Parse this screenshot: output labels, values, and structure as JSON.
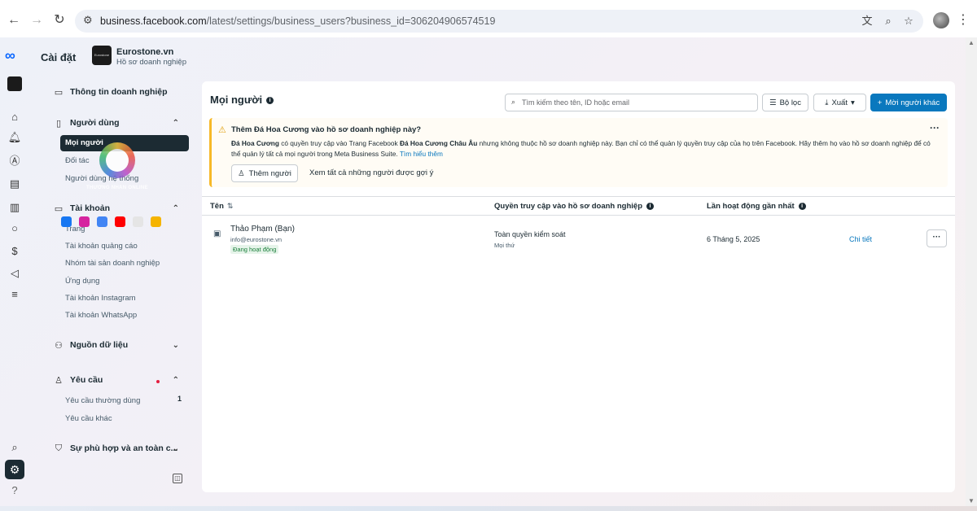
{
  "browser": {
    "url_domain": "business.facebook.com",
    "url_path": "/latest/settings/business_users?business_id=306204906574519"
  },
  "sidebar": {
    "title": "Cài đặt",
    "business_name": "Eurostone.vn",
    "business_sub": "Hồ sơ doanh nghiệp",
    "business_logo_text": "Eurostone",
    "sections": {
      "business_info": "Thông tin doanh nghiệp",
      "users": "Người dùng",
      "users_items": [
        "Mọi người",
        "Đối tác",
        "Người dùng hệ thống"
      ],
      "accounts": "Tài khoản",
      "accounts_items": [
        "Trang",
        "Tài khoản quảng cáo",
        "Nhóm tài sản doanh nghiệp",
        "Ứng dụng",
        "Tài khoản Instagram",
        "Tài khoản WhatsApp"
      ],
      "data_sources": "Nguồn dữ liệu",
      "requests": "Yêu cầu",
      "requests_items": [
        "Yêu cầu thường dùng",
        "Yêu cầu khác"
      ],
      "requests_count": "1",
      "compliance": "Sự phù hợp và an toàn c..."
    }
  },
  "main": {
    "title": "Mọi người",
    "search_placeholder": "Tìm kiếm theo tên, ID hoặc email",
    "filter_label": "Bộ lọc",
    "export_label": "Xuất",
    "new_person_label": "Mời người khác",
    "alert": {
      "title": "Thêm Đá Hoa Cương vào hồ sơ doanh nghiệp này?",
      "body_name": "Đá Hoa Cương",
      "body_1": " có quyền truy cập vào Trang Facebook ",
      "body_page": "Đá Hoa Cương Châu Âu",
      "body_2": " nhưng không thuộc hồ sơ doanh nghiệp này. Bạn chỉ có thể quản lý quyền truy cập của họ trên Facebook. Hãy thêm họ vào hồ sơ doanh nghiệp để có thể quản lý tất cả mọi người trong Meta Business Suite. ",
      "learn_more": "Tìm hiểu thêm",
      "add_button": "Thêm người",
      "see_all": "Xem tất cả những người được gợi ý"
    },
    "table": {
      "col_name": "Tên",
      "col_access": "Quyền truy cập vào hồ sơ doanh nghiệp",
      "col_last": "Lần hoạt động gần nhất",
      "rows": [
        {
          "name": "Thảo Phạm (Bạn)",
          "email": "info@eurostone.vn",
          "status": "Đang hoạt động",
          "access": "Toàn quyền kiểm soát",
          "access_sub": "Mọi thứ",
          "last_active": "6 Tháng 5, 2025",
          "detail": "Chi tiết"
        }
      ]
    }
  },
  "watermark": {
    "text": "THƯƠNG NHÂN ONLINE"
  },
  "colors": {
    "accent": "#0a78be",
    "meta_blue": "#0866ff",
    "warning": "#f7b928",
    "active_nav": "#1c2b33"
  }
}
